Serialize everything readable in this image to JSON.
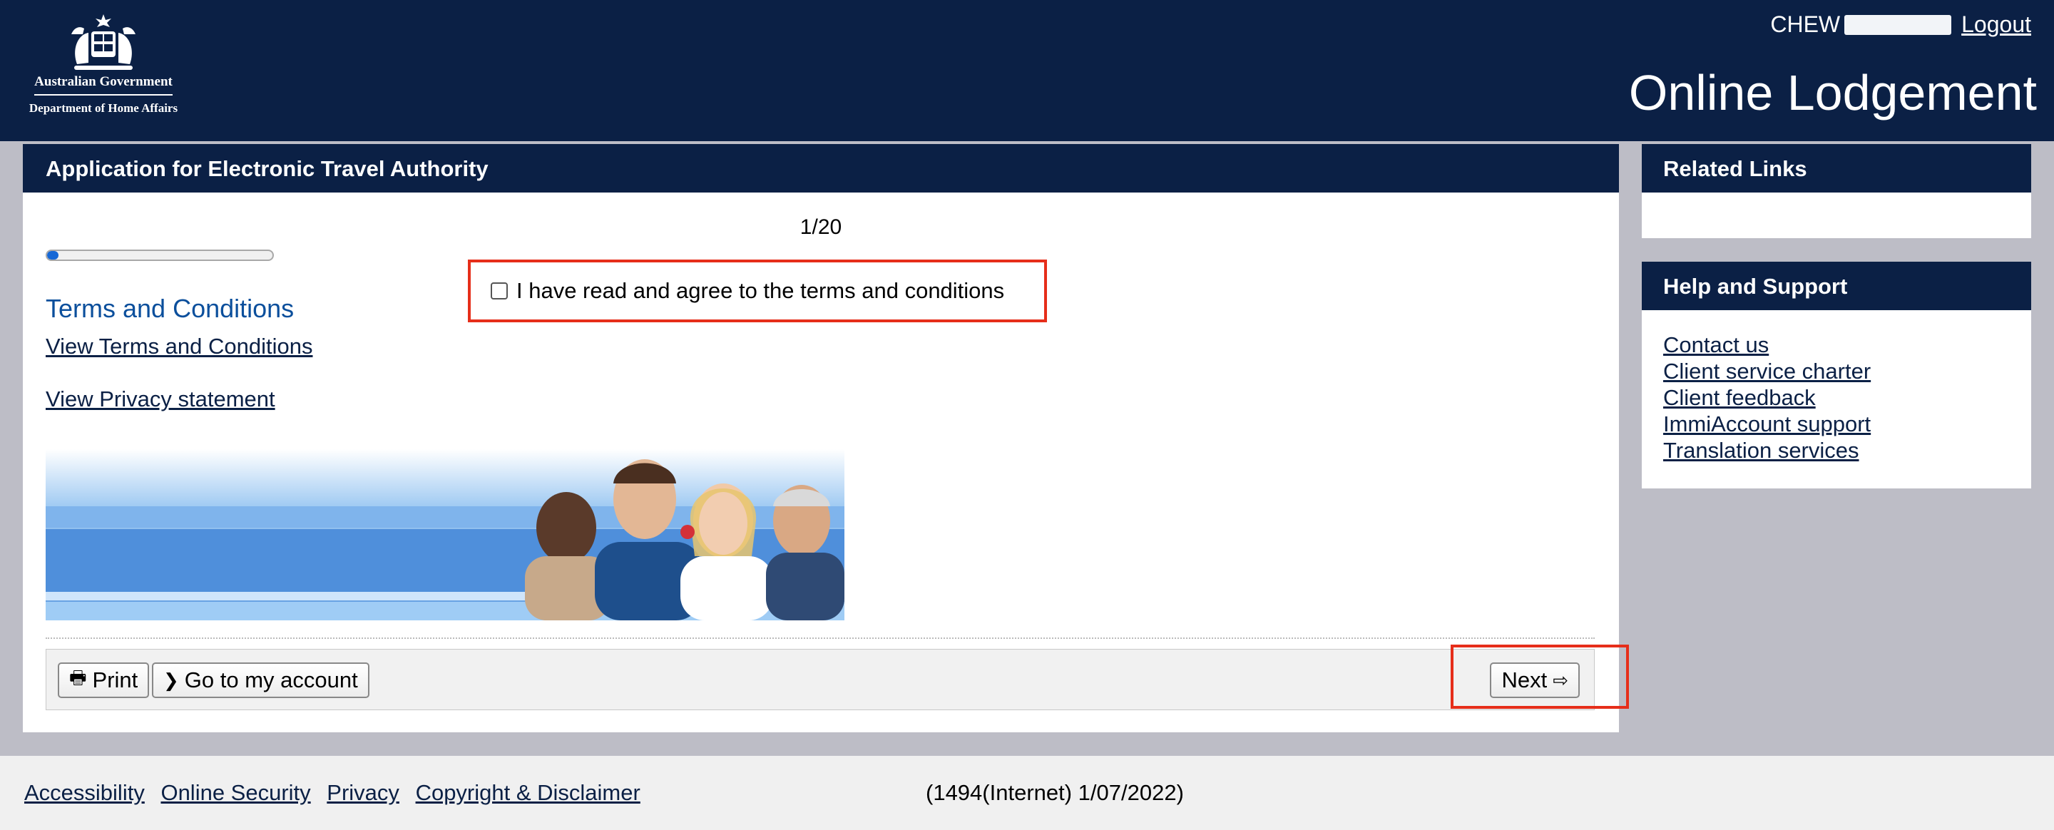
{
  "header": {
    "logo_line1": "Australian Government",
    "logo_line2": "Department of Home Affairs",
    "user_name": "CHEW",
    "logout_label": "Logout",
    "portal_title": "Online Lodgement"
  },
  "main": {
    "title": "Application for Electronic Travel Authority",
    "step_label": "1/20",
    "progress": {
      "current": 1,
      "total": 20
    },
    "section_title": "Terms and Conditions",
    "view_terms_link": "View Terms and Conditions",
    "view_privacy_link": "View Privacy statement",
    "agree_checkbox": {
      "label": "I have read and agree to the terms and conditions",
      "checked": false
    }
  },
  "buttons": {
    "print_label": "Print",
    "account_label": "Go to my account",
    "next_label": "Next"
  },
  "sidebar": {
    "related_title": "Related Links",
    "help_title": "Help and Support",
    "help_links": [
      "Contact us",
      "Client service charter",
      "Client feedback",
      "ImmiAccount support",
      "Translation services"
    ]
  },
  "footer": {
    "links": [
      "Accessibility",
      "Online Security",
      "Privacy",
      "Copyright & Disclaimer"
    ],
    "version": "(1494(Internet) 1/07/2022)"
  },
  "colors": {
    "navy": "#0b2045",
    "accent_blue": "#0b4f9c",
    "highlight_red": "#e62e1a",
    "progress_blue": "#1668d6"
  }
}
